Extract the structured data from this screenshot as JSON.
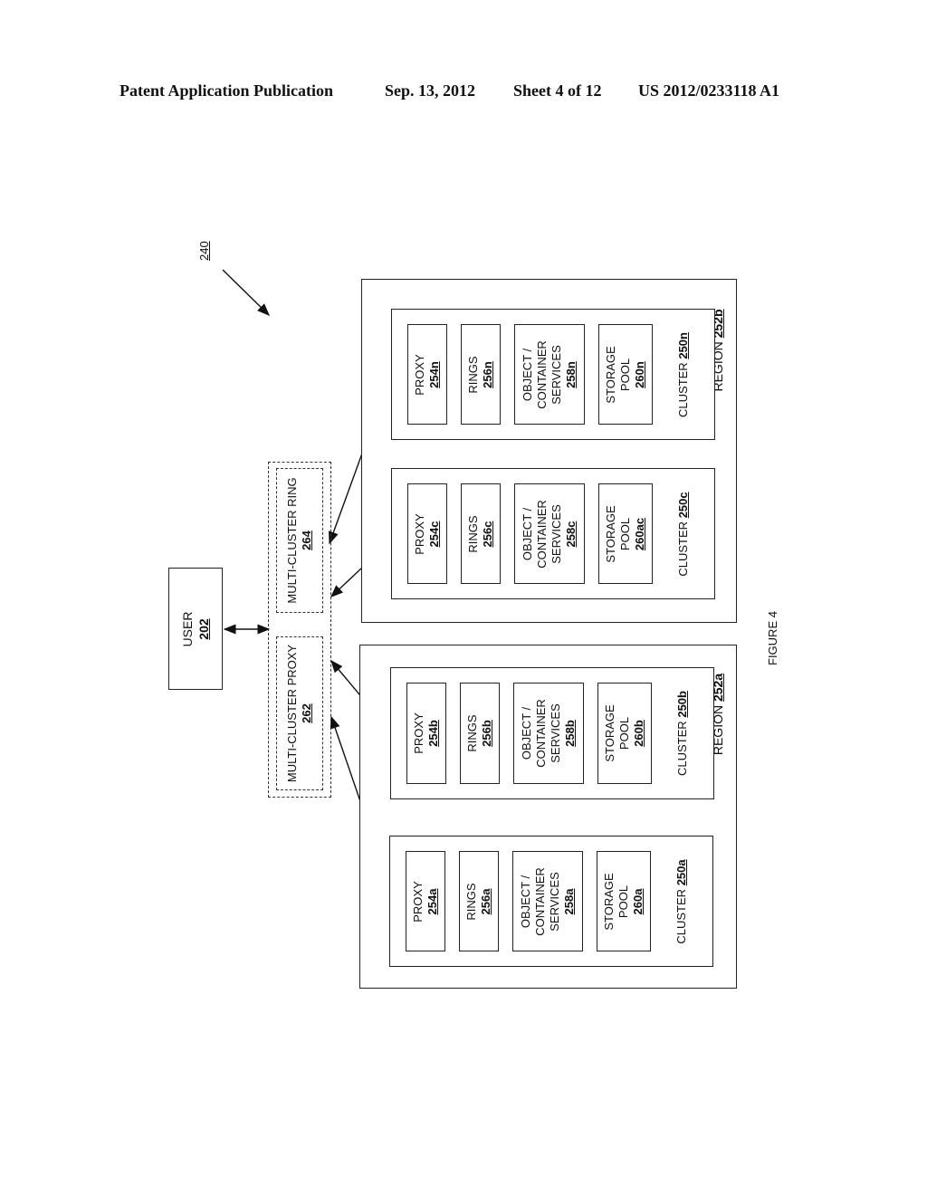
{
  "header": {
    "publication": "Patent Application Publication",
    "date": "Sep. 13, 2012",
    "sheet": "Sheet 4 of 12",
    "number": "US 2012/0233118 A1"
  },
  "figure": {
    "ref": "240",
    "caption": "FIGURE 4"
  },
  "user": {
    "label": "USER",
    "ref": "202"
  },
  "multi_cluster": {
    "proxy": {
      "label": "MULTI-CLUSTER PROXY",
      "ref": "262"
    },
    "ring": {
      "label": "MULTI-CLUSTER RING",
      "ref": "264"
    }
  },
  "regions": [
    {
      "label": "REGION",
      "ref": "252b",
      "clusters": [
        {
          "label": "CLUSTER",
          "ref": "250n",
          "proxy": {
            "label": "PROXY",
            "ref": "254n"
          },
          "rings": {
            "label": "RINGS",
            "ref": "256n"
          },
          "services": {
            "l1": "OBJECT /",
            "l2": "CONTAINER",
            "l3": "SERVICES",
            "ref": "258n"
          },
          "storage": {
            "l1": "STORAGE",
            "l2": "POOL",
            "ref": "260n"
          }
        },
        {
          "label": "CLUSTER",
          "ref": "250c",
          "proxy": {
            "label": "PROXY",
            "ref": "254c"
          },
          "rings": {
            "label": "RINGS",
            "ref": "256c"
          },
          "services": {
            "l1": "OBJECT /",
            "l2": "CONTAINER",
            "l3": "SERVICES",
            "ref": "258c"
          },
          "storage": {
            "l1": "STORAGE",
            "l2": "POOL",
            "ref": "260ac"
          }
        }
      ]
    },
    {
      "label": "REGION",
      "ref": "252a",
      "clusters": [
        {
          "label": "CLUSTER",
          "ref": "250b",
          "proxy": {
            "label": "PROXY",
            "ref": "254b"
          },
          "rings": {
            "label": "RINGS",
            "ref": "256b"
          },
          "services": {
            "l1": "OBJECT /",
            "l2": "CONTAINER",
            "l3": "SERVICES",
            "ref": "258b"
          },
          "storage": {
            "l1": "STORAGE",
            "l2": "POOL",
            "ref": "260b"
          }
        },
        {
          "label": "CLUSTER",
          "ref": "250a",
          "proxy": {
            "label": "PROXY",
            "ref": "254a"
          },
          "rings": {
            "label": "RINGS",
            "ref": "256a"
          },
          "services": {
            "l1": "OBJECT /",
            "l2": "CONTAINER",
            "l3": "SERVICES",
            "ref": "258a"
          },
          "storage": {
            "l1": "STORAGE",
            "l2": "POOL",
            "ref": "260a"
          }
        }
      ]
    }
  ]
}
